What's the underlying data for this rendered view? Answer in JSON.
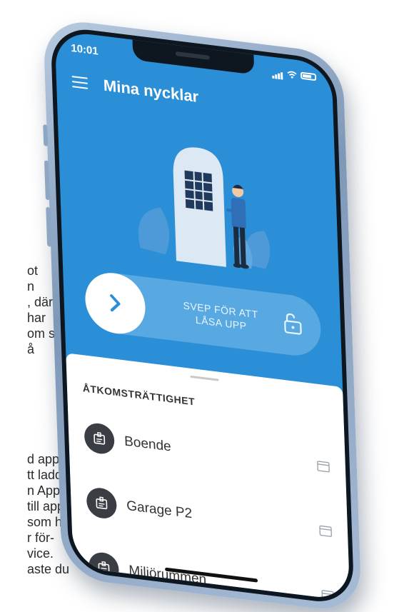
{
  "background_text": {
    "lines": [
      "ot",
      "n",
      ", där",
      "har",
      "om så",
      "å",
      "",
      "",
      "d appen",
      "tt ladda",
      "n App",
      "till appen",
      "som har",
      "r för-",
      "vice.",
      "aste du"
    ]
  },
  "status_bar": {
    "time": "10:01"
  },
  "header": {
    "title": "Mina nycklar"
  },
  "swipe": {
    "label_line1": "SVEP FÖR ATT",
    "label_line2": "LÅSA UPP"
  },
  "access": {
    "heading": "ÅTKOMSTRÄTTIGHET",
    "items": [
      {
        "label": "Boende",
        "icon": "badge-icon"
      },
      {
        "label": "Garage P2",
        "icon": "badge-icon"
      },
      {
        "label": "Miljörummen",
        "icon": "badge-icon"
      }
    ]
  },
  "colors": {
    "primary": "#2a8fd6",
    "swipe_track": "#58a9e2",
    "row_icon_bg": "#3a3d43",
    "sheet_bg": "#ffffff"
  }
}
